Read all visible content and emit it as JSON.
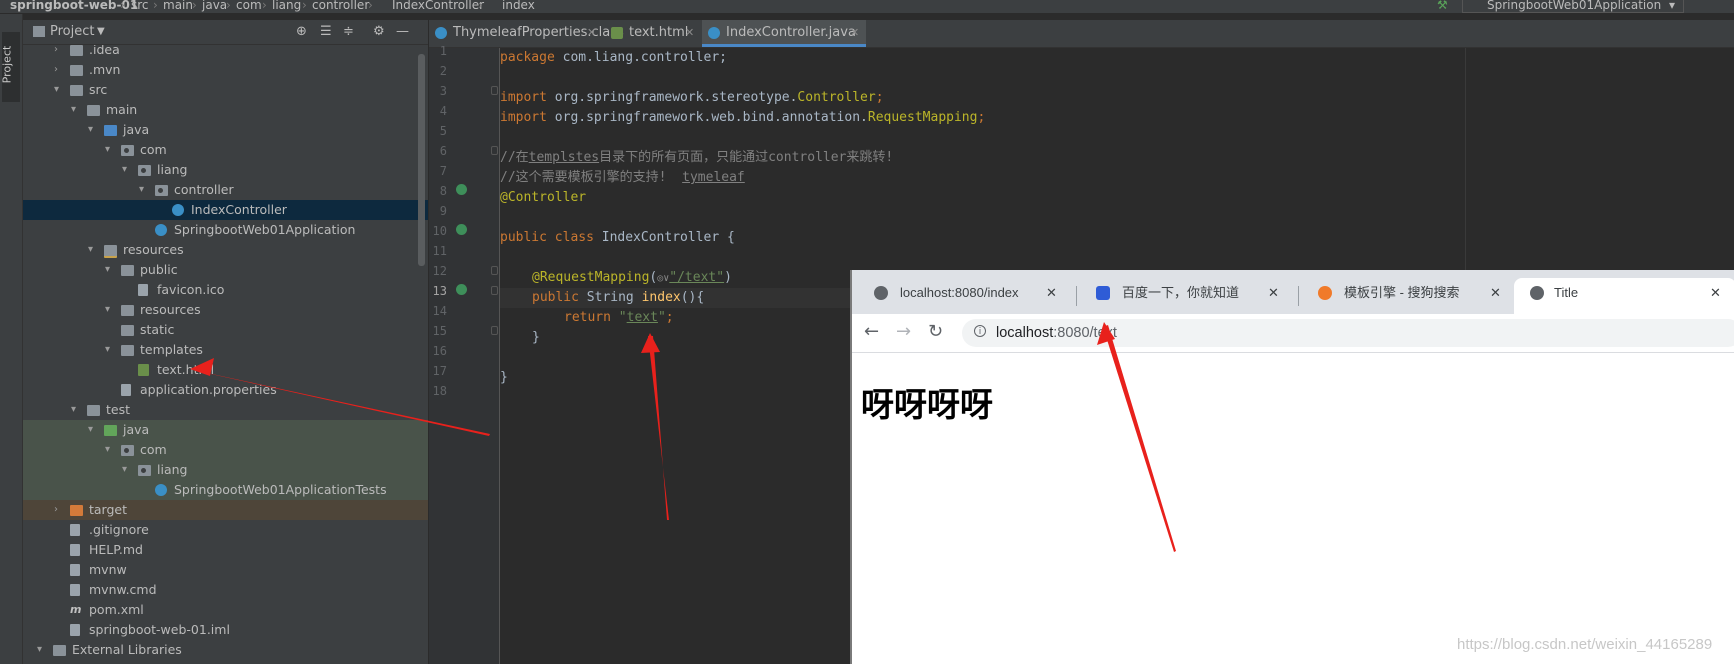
{
  "breadcrumb": [
    "springboot-web-01",
    "src",
    "main",
    "java",
    "com",
    "liang",
    "controller",
    "IndexController",
    "index"
  ],
  "run_config": "SpringbootWeb01Application",
  "side_tab": "Project",
  "project_panel": {
    "title": "Project",
    "tree": [
      {
        "label": ".idea",
        "depth": 1,
        "icon": "folder",
        "chev": "right"
      },
      {
        "label": ".mvn",
        "depth": 1,
        "icon": "folder",
        "chev": "right"
      },
      {
        "label": "src",
        "depth": 1,
        "icon": "folder",
        "chev": "down"
      },
      {
        "label": "main",
        "depth": 2,
        "icon": "folder",
        "chev": "down"
      },
      {
        "label": "java",
        "depth": 3,
        "icon": "folder-blue",
        "chev": "down"
      },
      {
        "label": "com",
        "depth": 4,
        "icon": "pkg",
        "chev": "down"
      },
      {
        "label": "liang",
        "depth": 5,
        "icon": "pkg",
        "chev": "down"
      },
      {
        "label": "controller",
        "depth": 6,
        "icon": "pkg",
        "chev": "down"
      },
      {
        "label": "IndexController",
        "depth": 7,
        "icon": "class",
        "chev": "",
        "selected": true
      },
      {
        "label": "SpringbootWeb01Application",
        "depth": 6,
        "icon": "class",
        "chev": ""
      },
      {
        "label": "resources",
        "depth": 3,
        "icon": "folder-res",
        "chev": "down"
      },
      {
        "label": "public",
        "depth": 4,
        "icon": "folder",
        "chev": "down"
      },
      {
        "label": "favicon.ico",
        "depth": 5,
        "icon": "file",
        "chev": ""
      },
      {
        "label": "resources",
        "depth": 4,
        "icon": "folder",
        "chev": "down"
      },
      {
        "label": "static",
        "depth": 4,
        "icon": "folder",
        "chev": ""
      },
      {
        "label": "templates",
        "depth": 4,
        "icon": "folder",
        "chev": "down"
      },
      {
        "label": "text.html",
        "depth": 5,
        "icon": "html",
        "chev": ""
      },
      {
        "label": "application.properties",
        "depth": 4,
        "icon": "file",
        "chev": ""
      },
      {
        "label": "test",
        "depth": 2,
        "icon": "folder",
        "chev": "down"
      },
      {
        "label": "java",
        "depth": 3,
        "icon": "folder-green",
        "chev": "down",
        "test": true
      },
      {
        "label": "com",
        "depth": 4,
        "icon": "pkg",
        "chev": "down",
        "test": true
      },
      {
        "label": "liang",
        "depth": 5,
        "icon": "pkg",
        "chev": "down",
        "test": true
      },
      {
        "label": "SpringbootWeb01ApplicationTests",
        "depth": 6,
        "icon": "class",
        "chev": "",
        "test": true
      },
      {
        "label": "target",
        "depth": 1,
        "icon": "folder-orange",
        "chev": "right",
        "excluded": true
      },
      {
        "label": ".gitignore",
        "depth": 1,
        "icon": "file",
        "chev": ""
      },
      {
        "label": "HELP.md",
        "depth": 1,
        "icon": "file",
        "chev": ""
      },
      {
        "label": "mvnw",
        "depth": 1,
        "icon": "file",
        "chev": ""
      },
      {
        "label": "mvnw.cmd",
        "depth": 1,
        "icon": "file",
        "chev": ""
      },
      {
        "label": "pom.xml",
        "depth": 1,
        "icon": "maven",
        "chev": ""
      },
      {
        "label": "springboot-web-01.iml",
        "depth": 1,
        "icon": "file",
        "chev": ""
      },
      {
        "label": "External Libraries",
        "depth": 0,
        "icon": "library",
        "chev": "down"
      }
    ]
  },
  "editor_tabs": [
    {
      "label": "ThymeleafProperties.class",
      "active": false
    },
    {
      "label": "text.html",
      "active": false
    },
    {
      "label": "IndexController.java",
      "active": true
    }
  ],
  "code": {
    "line_numbers": [
      "1",
      "2",
      "3",
      "4",
      "5",
      "6",
      "7",
      "8",
      "9",
      "10",
      "11",
      "12",
      "13",
      "14",
      "15",
      "16",
      "17",
      "18"
    ],
    "l1_kw": "package",
    "l1_rest": " com.liang.controller;",
    "l3_kw": "import",
    "l3_rest": " org.springframework.stereotype.",
    "l3_cls": "Controller",
    "l3_end": ";",
    "l4_kw": "import",
    "l4_rest": " org.springframework.web.bind.annotation.",
    "l4_cls": "RequestMapping",
    "l4_end": ";",
    "l6_a": "//在",
    "l6_b": "templstes",
    "l6_c": "目录下的所有页面，只能通过controller来跳转!",
    "l7_a": "//这个需要模板引擎的支持!  ",
    "l7_b": "tymeleaf",
    "l8": "@Controller",
    "l10_kw": "public class",
    "l10_rest": " IndexController {",
    "l12_ann": "@RequestMapping",
    "l12_open": "(",
    "l12_sym": "◎∨",
    "l12_str": "\"/text\"",
    "l12_close": ")",
    "l13_kw": "public",
    "l13_type": " String ",
    "l13_fn": "index",
    "l13_rest": "(){",
    "l14_kw": "return",
    "l14_str_q1": "\"",
    "l14_str": "text",
    "l14_str_q2": "\"",
    "l14_end": ";",
    "l15": "}",
    "l17": "}"
  },
  "browser": {
    "tabs": [
      {
        "label": "localhost:8080/index",
        "favicon": "globe"
      },
      {
        "label": "百度一下，你就知道",
        "favicon": "baidu"
      },
      {
        "label": "模板引擎 - 搜狗搜索",
        "favicon": "sogou"
      },
      {
        "label": "Title",
        "favicon": "globe",
        "active": true
      }
    ],
    "close_glyph": "✕",
    "back": "←",
    "forward": "→",
    "reload": "↻",
    "info": "i",
    "url_host": "localhost",
    "url_rest": ":8080/text",
    "page_heading": "呀呀呀呀"
  },
  "watermark": "https://blog.csdn.net/weixin_44165289",
  "colors": {
    "annotation_arrow": "#e8211c",
    "accent": "#4a88c7"
  }
}
